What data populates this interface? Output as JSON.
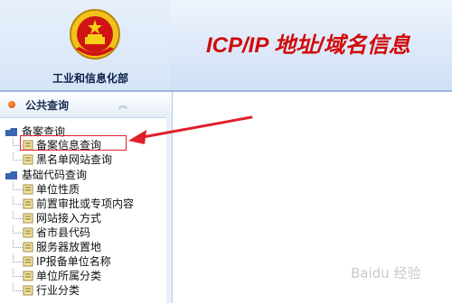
{
  "header": {
    "ministry_name": "工业和信息化部",
    "app_title": "ICP/IP 地址/域名信息"
  },
  "sidebar": {
    "title": "公共查询",
    "collapse_icon": "double-chevron-up-icon",
    "groups": [
      {
        "label": "备案查询",
        "items": [
          {
            "label": "备案信息查询",
            "highlighted": true
          },
          {
            "label": "黑名单网站查询"
          }
        ]
      },
      {
        "label": "基础代码查询",
        "items": [
          {
            "label": "单位性质"
          },
          {
            "label": "前置审批或专项内容"
          },
          {
            "label": "网站接入方式"
          },
          {
            "label": "省市县代码"
          },
          {
            "label": "服务器放置地"
          },
          {
            "label": "IP报备单位名称"
          },
          {
            "label": "单位所属分类"
          },
          {
            "label": "行业分类"
          }
        ]
      }
    ]
  },
  "watermark": "Baidu 经验",
  "colors": {
    "title_red": "#d10a0a",
    "highlight_border": "#e0202a",
    "arrow_red": "#e0202a",
    "header_blue": "#d6e5f7"
  }
}
